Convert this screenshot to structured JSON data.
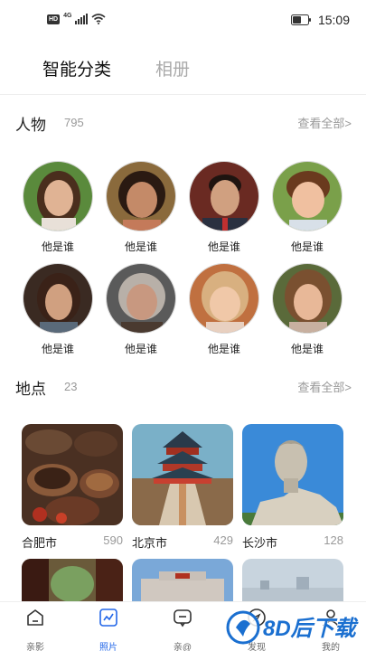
{
  "status_bar": {
    "hd": "HD",
    "signal": "4G",
    "time": "15:09"
  },
  "tabs": [
    {
      "label": "智能分类",
      "active": true
    },
    {
      "label": "相册",
      "active": false
    }
  ],
  "people_section": {
    "title": "人物",
    "count": "795",
    "see_all": "查看全部>",
    "people": [
      {
        "label": "他是谁"
      },
      {
        "label": "他是谁"
      },
      {
        "label": "他是谁"
      },
      {
        "label": "他是谁"
      },
      {
        "label": "他是谁"
      },
      {
        "label": "他是谁"
      },
      {
        "label": "他是谁"
      },
      {
        "label": "他是谁"
      }
    ]
  },
  "places_section": {
    "title": "地点",
    "count": "23",
    "see_all": "查看全部>",
    "places": [
      {
        "name": "合肥市",
        "count": "590"
      },
      {
        "name": "北京市",
        "count": "429"
      },
      {
        "name": "长沙市",
        "count": "128"
      }
    ]
  },
  "bottom_nav": [
    {
      "label": "亲影",
      "icon": "home-icon",
      "active": false
    },
    {
      "label": "照片",
      "icon": "photo-chart-icon",
      "active": true
    },
    {
      "label": "亲@",
      "icon": "message-icon",
      "active": false
    },
    {
      "label": "发现",
      "icon": "discover-icon",
      "active": false
    },
    {
      "label": "我的",
      "icon": "profile-icon",
      "active": false
    }
  ],
  "watermark": {
    "text": "8D后下载"
  },
  "colors": {
    "accent": "#2266e8",
    "muted": "#999999"
  }
}
